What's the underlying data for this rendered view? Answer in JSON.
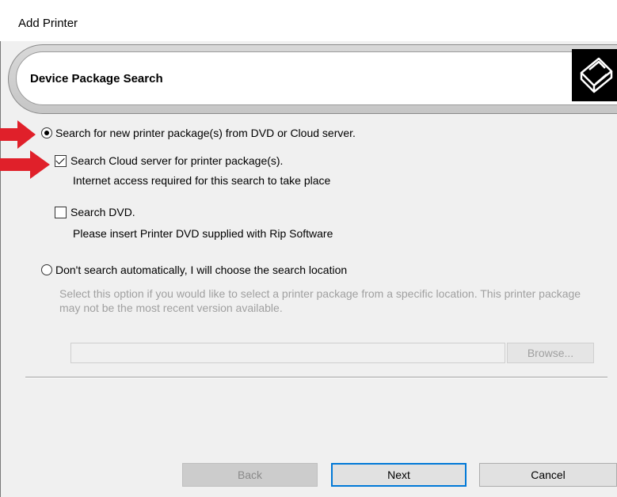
{
  "window": {
    "title": "Add Printer"
  },
  "banner": {
    "title": "Device Package Search",
    "icon": "printer-icon"
  },
  "options": {
    "search_packages": {
      "label": "Search for new printer package(s) from DVD or Cloud server.",
      "selected": true
    },
    "cloud": {
      "label": "Search Cloud server for printer package(s).",
      "note": "Internet access required for this search to take place",
      "checked": true
    },
    "dvd": {
      "label": "Search DVD.",
      "note": "Please insert Printer DVD supplied with Rip Software",
      "checked": false
    },
    "manual": {
      "label": "Don't search automatically, I will choose the search location",
      "description": "Select this option if you would like to select a printer package from a specific location. This printer package may not be the most recent version available.",
      "selected": false
    }
  },
  "path": {
    "value": "",
    "browse_label": "Browse..."
  },
  "buttons": {
    "back": "Back",
    "next": "Next",
    "cancel": "Cancel"
  },
  "colors": {
    "accent": "#0078d7",
    "annotation_arrow": "#e0202a"
  }
}
